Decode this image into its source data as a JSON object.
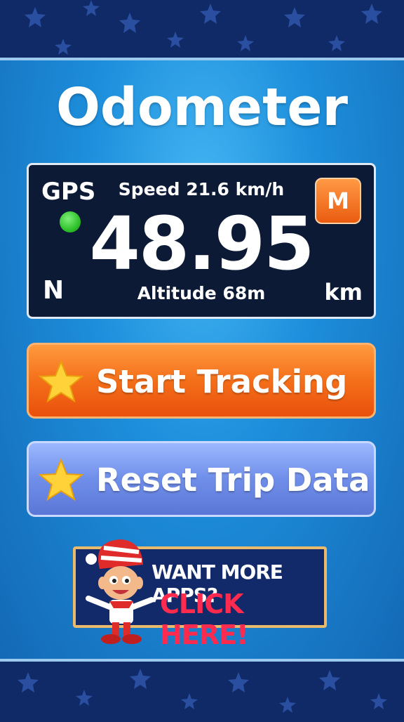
{
  "app": {
    "title": "Odometer"
  },
  "readout": {
    "gps_label": "GPS",
    "gps_status_color": "#2fc22b",
    "speed_text": "Speed 21.6 km/h",
    "distance_value": "48.95",
    "altitude_text": "Altitude 68m",
    "heading": "N",
    "unit": "km",
    "unit_toggle_label": "M"
  },
  "actions": {
    "start_label": "Start Tracking",
    "reset_label": "Reset Trip Data"
  },
  "promo": {
    "line1": "WANT MORE APPS?",
    "line2": "CLICK HERE!"
  },
  "colors": {
    "background": "#1d8fdc",
    "start_button": "#f46f1a",
    "reset_button": "#6f8ee9",
    "panel": "#0c1a35",
    "promo_accent": "#ff2b4f"
  },
  "icons": {
    "button_icon": "star-icon",
    "promo_icon": "elf-mascot-icon"
  }
}
